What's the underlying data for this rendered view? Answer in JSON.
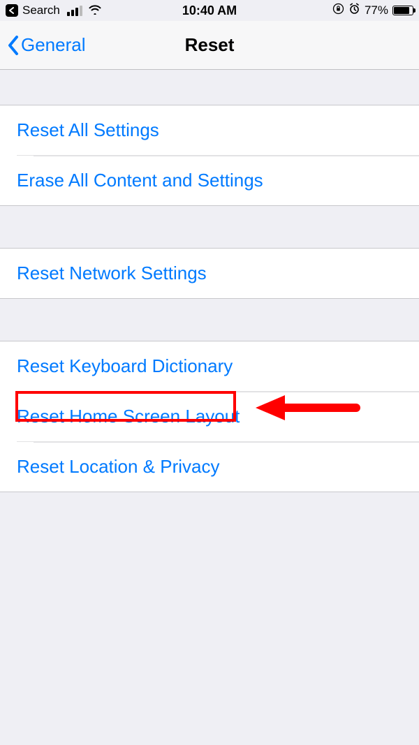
{
  "statusBar": {
    "backApp": "Search",
    "time": "10:40 AM",
    "battery": "77%"
  },
  "nav": {
    "back": "General",
    "title": "Reset"
  },
  "groups": {
    "g1": {
      "items": [
        "Reset All Settings",
        "Erase All Content and Settings"
      ]
    },
    "g2": {
      "items": [
        "Reset Network Settings"
      ]
    },
    "g3": {
      "items": [
        "Reset Keyboard Dictionary",
        "Reset Home Screen Layout",
        "Reset Location & Privacy"
      ]
    }
  },
  "annotation": {
    "highlightedItem": "Reset Home Screen Layout"
  }
}
